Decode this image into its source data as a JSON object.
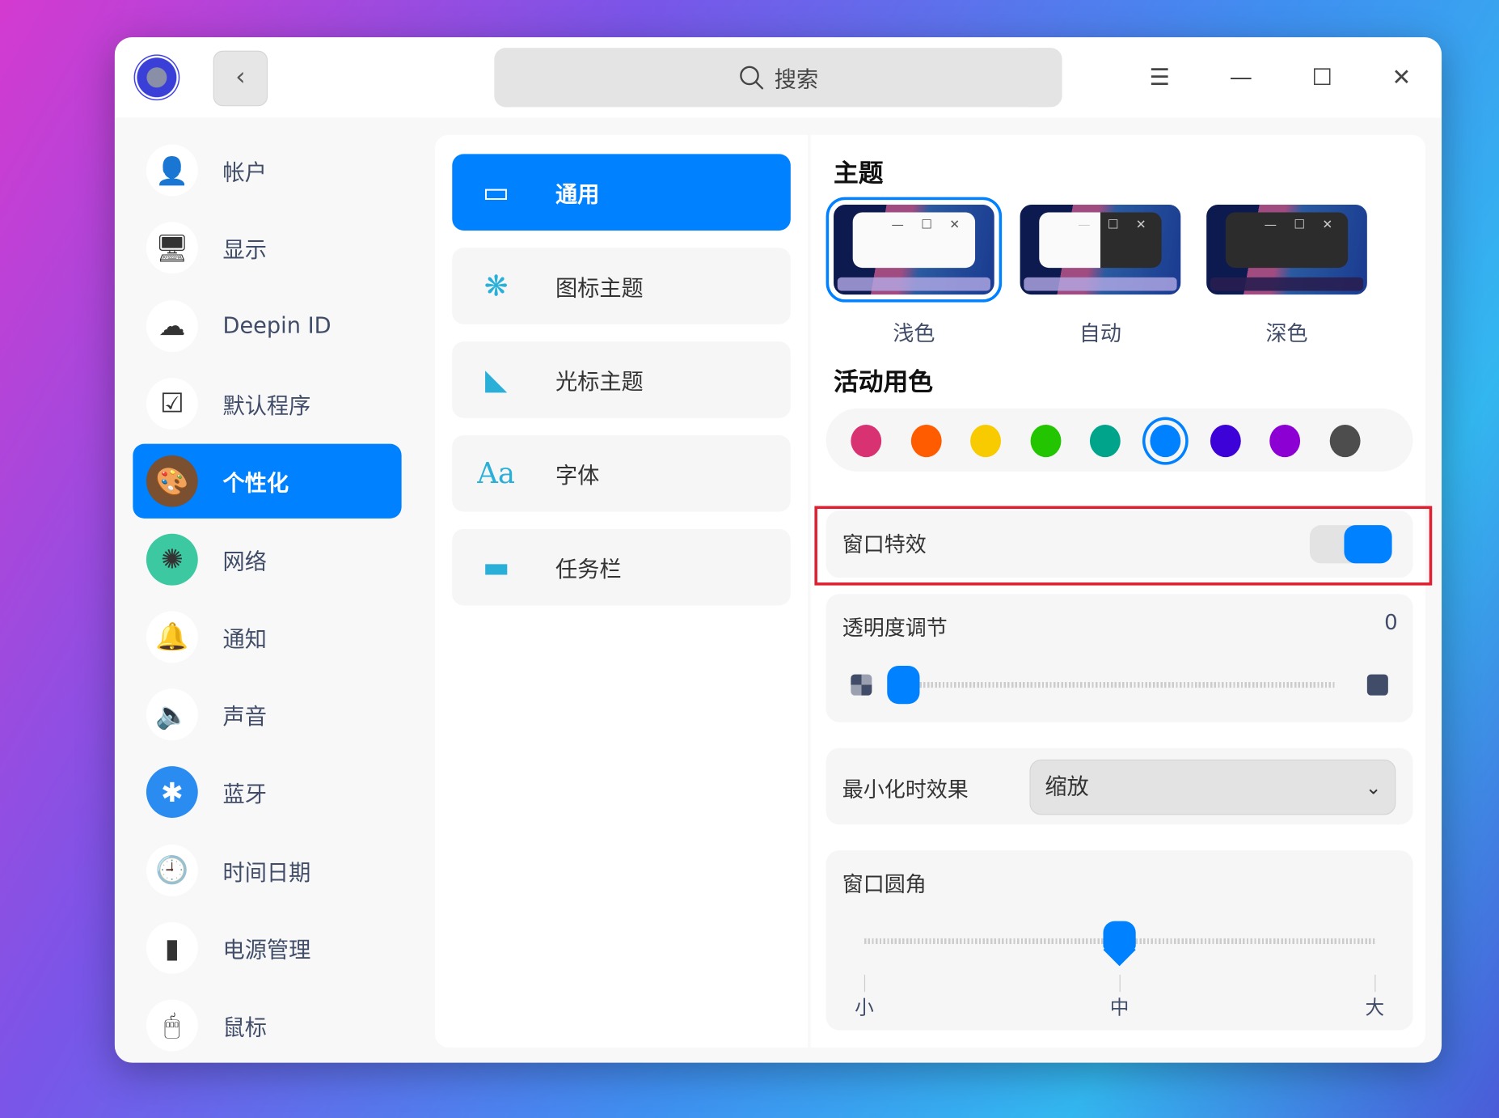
{
  "titlebar": {
    "search_placeholder": "搜索",
    "back_icon": "‹",
    "menu_icon": "☰",
    "minimize_icon": "—",
    "maximize_icon": "☐",
    "close_icon": "✕"
  },
  "sidebar": {
    "items": [
      {
        "label": "帐户"
      },
      {
        "label": "显示"
      },
      {
        "label": "Deepin ID"
      },
      {
        "label": "默认程序"
      },
      {
        "label": "个性化",
        "active": true
      },
      {
        "label": "网络"
      },
      {
        "label": "通知"
      },
      {
        "label": "声音"
      },
      {
        "label": "蓝牙"
      },
      {
        "label": "时间日期"
      },
      {
        "label": "电源管理"
      },
      {
        "label": "鼠标"
      }
    ]
  },
  "submenu": {
    "items": [
      {
        "label": "通用",
        "active": true
      },
      {
        "label": "图标主题"
      },
      {
        "label": "光标主题"
      },
      {
        "label": "字体",
        "icon_text": "Aa"
      },
      {
        "label": "任务栏"
      }
    ]
  },
  "main": {
    "theme_heading": "主题",
    "themes": [
      {
        "label": "浅色",
        "selected": true
      },
      {
        "label": "自动"
      },
      {
        "label": "深色"
      }
    ],
    "accent_heading": "活动用色",
    "accent_colors": [
      "#d83272",
      "#ff5c00",
      "#f8cb00",
      "#23c400",
      "#00a48a",
      "#0081ff",
      "#3c02d7",
      "#8c00d4",
      "#4d4d4d"
    ],
    "accent_selected": "#0081ff",
    "window_effect": {
      "label": "窗口特效",
      "enabled": true
    },
    "transparency": {
      "label": "透明度调节",
      "value": "0",
      "fraction": 0
    },
    "minimize_effect": {
      "label": "最小化时效果",
      "value": "缩放"
    },
    "corner": {
      "label": "窗口圆角",
      "ticks": [
        "小",
        "中",
        "大"
      ],
      "selected_index": 1
    }
  }
}
